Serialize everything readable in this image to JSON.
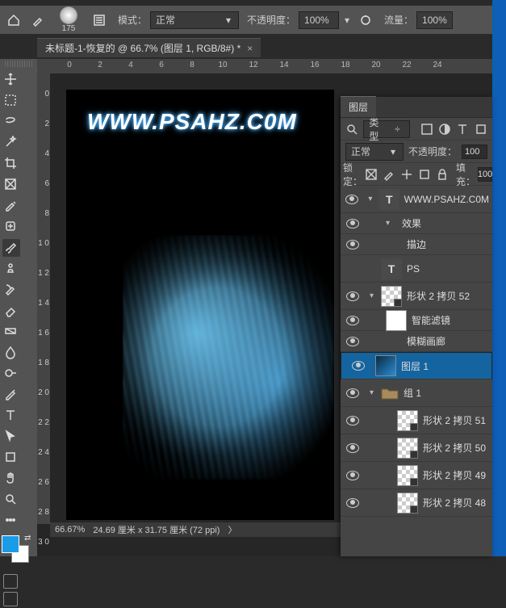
{
  "options_bar": {
    "mode_label": "模式：",
    "blend_mode": "正常",
    "opacity_label": "不透明度：",
    "opacity_value": "100%",
    "flow_label": "流量：",
    "flow_value": "100%",
    "brush_size": "175"
  },
  "tab": {
    "title": "未标题-1-恢复的 @ 66.7% (图层 1, RGB/8#) *"
  },
  "ruler_h": [
    "0",
    "2",
    "4",
    "6",
    "8",
    "10",
    "12",
    "14",
    "16",
    "18",
    "20",
    "22",
    "24"
  ],
  "ruler_v": [
    "0",
    "2",
    "4",
    "6",
    "8",
    "1 0",
    "1 2",
    "1 4",
    "1 6",
    "1 8",
    "2 0",
    "2 2",
    "2 4",
    "2 6",
    "2 8",
    "3 0"
  ],
  "canvas": {
    "watermark": "WWW.PSAHZ.C0M"
  },
  "statusbar": {
    "zoom": "66.67%",
    "info": "24.69 厘米 x 31.75 厘米 (72 ppi)"
  },
  "layers_panel": {
    "tab_label": "图层",
    "filter_label": "类型",
    "blend_label": "正常",
    "opacity_label": "不透明度：",
    "opacity_value": "100",
    "lock_label": "锁定：",
    "fill_label": "填充：",
    "fill_value": "100",
    "items": [
      {
        "type": "text",
        "indent": 0,
        "vis": true,
        "thumb": "T",
        "name": "WWW.PSAHZ.C0M",
        "twisty": "▾"
      },
      {
        "type": "fx",
        "indent": 1,
        "vis": true,
        "name": "效果",
        "twisty": "▾"
      },
      {
        "type": "fx",
        "indent": 2,
        "vis": true,
        "name": "描边"
      },
      {
        "type": "text",
        "indent": 0,
        "vis": false,
        "thumb": "T",
        "name": "PS"
      },
      {
        "type": "smart",
        "indent": 0,
        "vis": true,
        "thumb": "checker",
        "name": "形状 2 拷贝 52",
        "twisty": "▾"
      },
      {
        "type": "sf",
        "indent": 1,
        "vis": true,
        "thumb": "white",
        "name": "智能滤镜"
      },
      {
        "type": "sfe",
        "indent": 2,
        "vis": true,
        "name": "模糊画廊"
      },
      {
        "type": "layer",
        "indent": 0,
        "vis": true,
        "thumb": "art",
        "name": "图层 1",
        "selected": true
      },
      {
        "type": "group",
        "indent": 0,
        "vis": true,
        "name": "组 1",
        "twisty": "▾"
      },
      {
        "type": "smart",
        "indent": 1,
        "vis": true,
        "thumb": "checker",
        "name": "形状 2 拷贝 51"
      },
      {
        "type": "smart",
        "indent": 1,
        "vis": true,
        "thumb": "checker",
        "name": "形状 2 拷贝 50"
      },
      {
        "type": "smart",
        "indent": 1,
        "vis": true,
        "thumb": "checker",
        "name": "形状 2 拷贝 49"
      },
      {
        "type": "smart",
        "indent": 1,
        "vis": true,
        "thumb": "checker",
        "name": "形状 2 拷贝 48"
      }
    ]
  }
}
